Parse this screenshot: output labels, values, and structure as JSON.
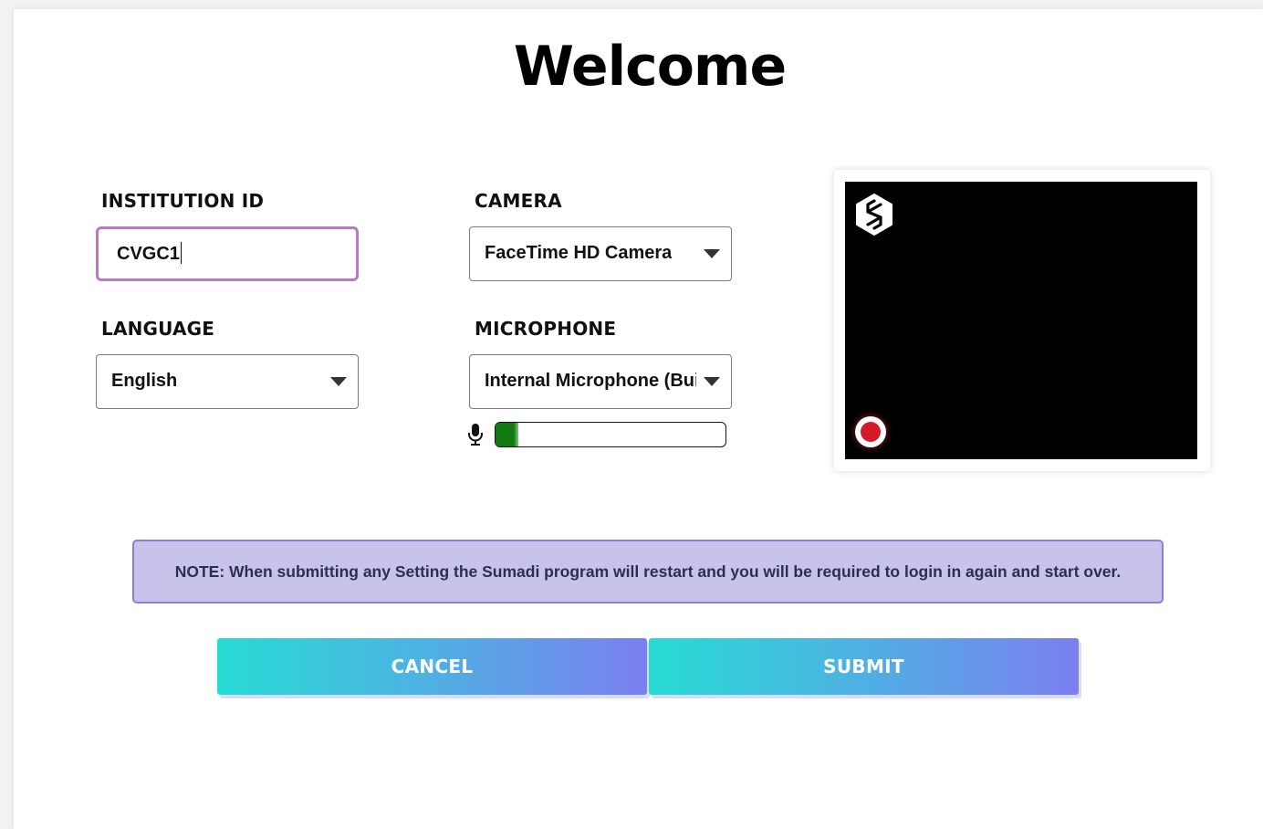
{
  "page": {
    "title": "Welcome"
  },
  "form": {
    "institution": {
      "label": "INSTITUTION ID",
      "value": "CVGC1"
    },
    "language": {
      "label": "LANGUAGE",
      "selected": "English"
    },
    "camera": {
      "label": "CAMERA",
      "selected": "FaceTime HD Camera"
    },
    "microphone": {
      "label": "MICROPHONE",
      "selected": "Internal Microphone (Built-in)",
      "level_percent": 10,
      "level_color": "#117a11"
    }
  },
  "preview": {
    "logo_icon": "sumadi-logo-icon",
    "record_icon": "record-indicator-icon",
    "record_color": "#d61a2a"
  },
  "note": {
    "text": "NOTE: When submitting any Setting the Sumadi program will restart and you will be required to login in again and start over."
  },
  "actions": {
    "cancel_label": "CANCEL",
    "submit_label": "SUBMIT"
  },
  "colors": {
    "accent_start": "#27dcd4",
    "accent_end": "#7b7ff0",
    "note_background": "#c7c3ea",
    "note_border": "#8b80d8",
    "input_focus_border": "#b57bbd"
  }
}
